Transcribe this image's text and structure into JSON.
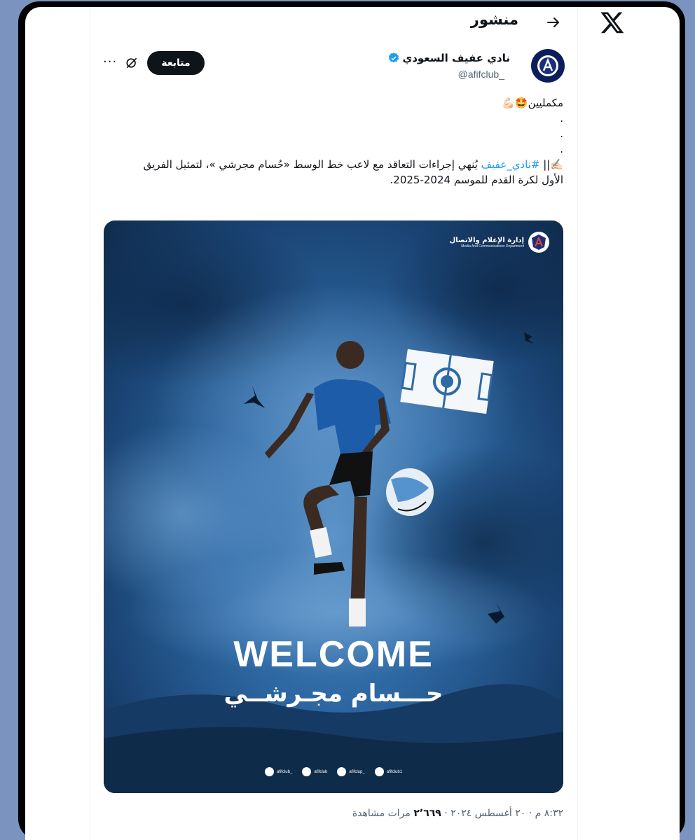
{
  "header": {
    "title": "منشور"
  },
  "author": {
    "name": "نادي عفيف السعودي",
    "handle": "@afifclub_",
    "follow_label": "متابعة"
  },
  "tweet": {
    "line1": "مكمليين🤩💪🏻",
    "dots": [
      ".",
      ".",
      "."
    ],
    "line_main_prefix": "✍🏻|| ",
    "hashtag": "#نادي_عفيف",
    "line_main_rest": " يُنهي إجراءات التعاقد مع لاعب خط الوسط «حُسام مجرشي »، لتمثيل الفريق",
    "line_last": "الأول لكرة القدم للموسم 2024-2025."
  },
  "media": {
    "dept_ar": "إدارة الإعلام والاتصال",
    "dept_en": "Media And Communications Department",
    "welcome": "WELCOME",
    "player_name": "حـــسام مجـرشــي",
    "socials": [
      "afifclub_",
      "afifclub",
      "afifclup_",
      "afifclub1"
    ]
  },
  "footer": {
    "time_date": "٨:٣٢ م · ٢٠ أغسطس ٢٠٢٤ · ",
    "views_count": "٢٬٦٦٩",
    "views_label": " مرات مشاهدة"
  },
  "colors": {
    "accent": "#1d9bf0",
    "text": "#0f1419",
    "muted": "#536471",
    "frame": "#7b93bf"
  },
  "icons": [
    "x-logo-icon",
    "back-arrow-icon",
    "verified-badge-icon",
    "grok-icon",
    "more-icon"
  ]
}
